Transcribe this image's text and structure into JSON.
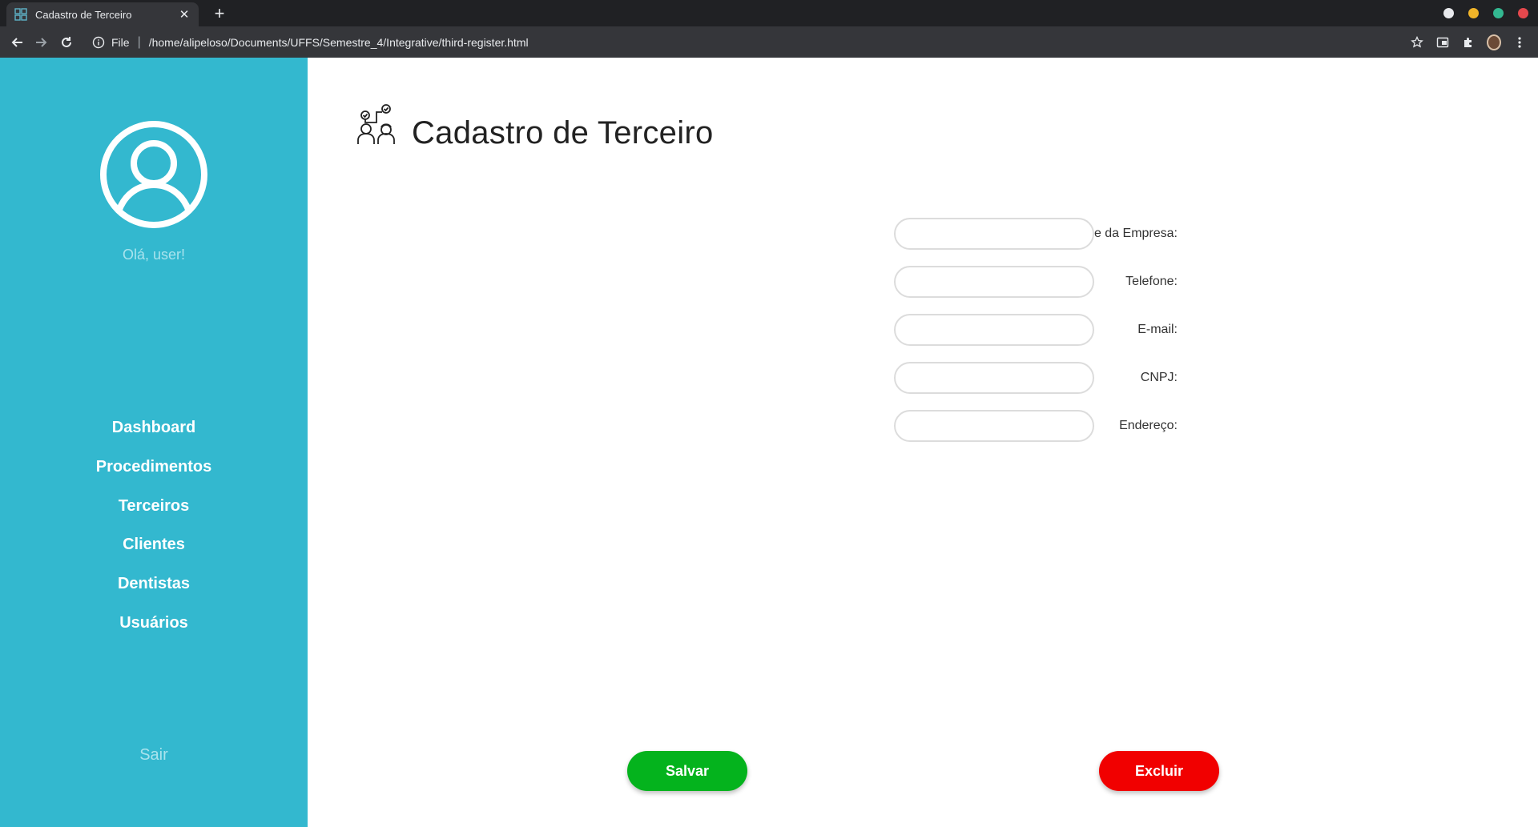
{
  "browser": {
    "tab_title": "Cadastro de Terceiro",
    "url_scheme": "File",
    "url_path": "/home/alipeloso/Documents/UFFS/Semestre_4/Integrative/third-register.html",
    "window_dots": [
      "#e8eaed",
      "#f0b429",
      "#33b891",
      "#e5484d"
    ]
  },
  "sidebar": {
    "greeting": "Olá, user!",
    "nav": [
      {
        "label": "Dashboard"
      },
      {
        "label": "Procedimentos"
      },
      {
        "label": "Terceiros"
      },
      {
        "label": "Clientes"
      },
      {
        "label": "Dentistas"
      },
      {
        "label": "Usuários"
      }
    ],
    "logout": "Sair",
    "color": "#33b8cf"
  },
  "main": {
    "title": "Cadastro de Terceiro",
    "fields": [
      {
        "label": "Nome da Empresa:",
        "value": "",
        "placeholder": ""
      },
      {
        "label": "Telefone:",
        "value": "",
        "placeholder": ""
      },
      {
        "label": "E-mail:",
        "value": "",
        "placeholder": ""
      },
      {
        "label": "CNPJ:",
        "value": "",
        "placeholder": ""
      },
      {
        "label": "Endereço:",
        "value": "",
        "placeholder": ""
      }
    ],
    "save_label": "Salvar",
    "delete_label": "Excluir",
    "save_color": "#04b31d",
    "delete_color": "#f10000"
  }
}
